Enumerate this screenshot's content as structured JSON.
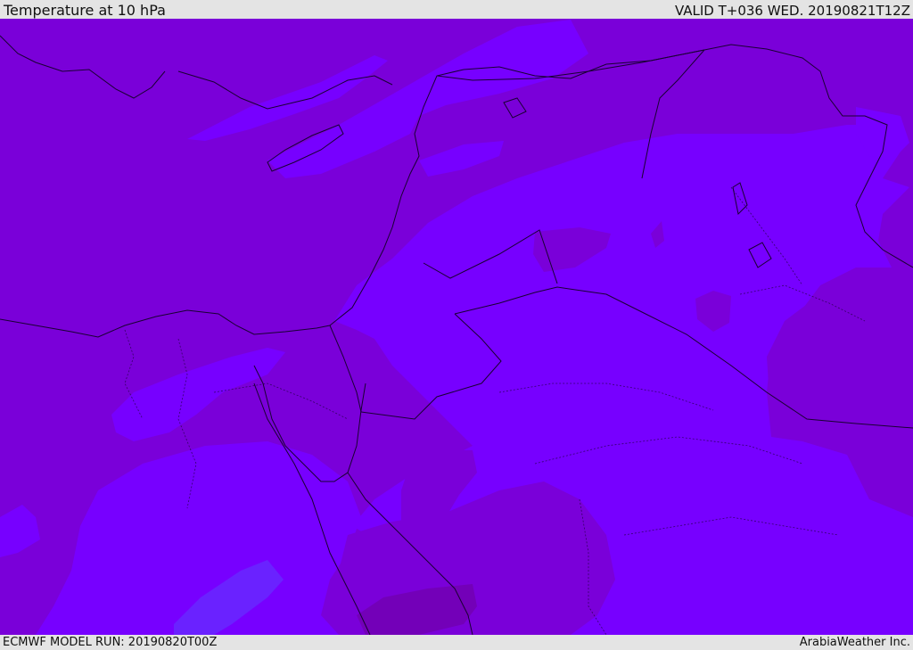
{
  "header": {
    "title": "Temperature at 10 hPa",
    "valid": "VALID T+036 WED. 20190821T12Z"
  },
  "footer": {
    "model_run": "ECMWF MODEL RUN: 20190820T00Z",
    "brand": "ArabiaWeather Inc."
  },
  "colors": {
    "band_dark": "#7a00d9",
    "band_mid": "#7700ff",
    "band_light": "#6a21ff",
    "band_deep": "#7900c0",
    "coastline": "#1a0033"
  }
}
